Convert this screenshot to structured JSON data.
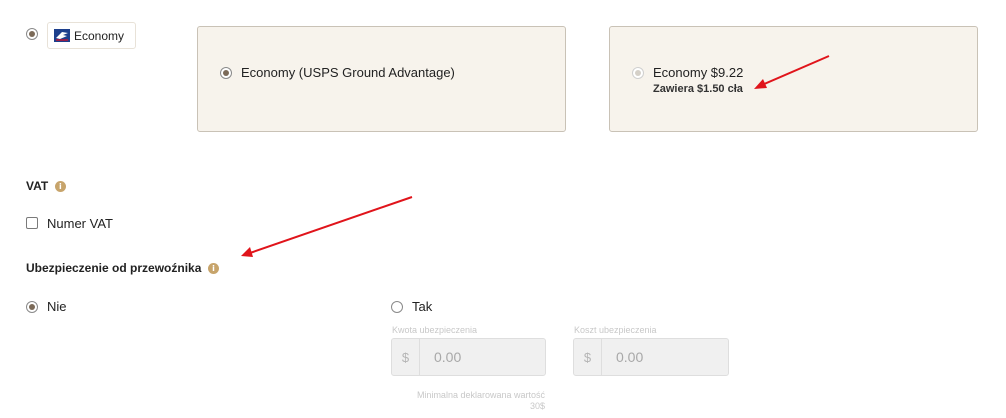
{
  "carrier": {
    "option_label": "Economy",
    "logo_icon": "usps-eagle-icon",
    "selected": true
  },
  "service_card": {
    "label": "Economy (USPS Ground Advantage)",
    "selected": true
  },
  "price_card": {
    "label": "Economy $9.22",
    "sublabel": "Zawiera $1.50 cła",
    "selected": true,
    "disabled": true
  },
  "vat": {
    "heading": "VAT",
    "info_icon": "info-icon",
    "checkbox_label": "Numer VAT",
    "checked": false
  },
  "insurance": {
    "heading": "Ubezpieczenie od przewoźnika",
    "info_icon": "info-icon",
    "options": [
      {
        "label": "Nie",
        "selected": true
      },
      {
        "label": "Tak",
        "selected": false
      }
    ],
    "amount_label": "Kwota ubezpieczenia",
    "cost_label": "Koszt ubezpieczenia",
    "currency_symbol": "$",
    "amount_value": "0.00",
    "cost_value": "0.00",
    "min_note": "Minimalna deklarowana wartość",
    "min_value": "30$"
  },
  "annotation_color": "#e0141b"
}
